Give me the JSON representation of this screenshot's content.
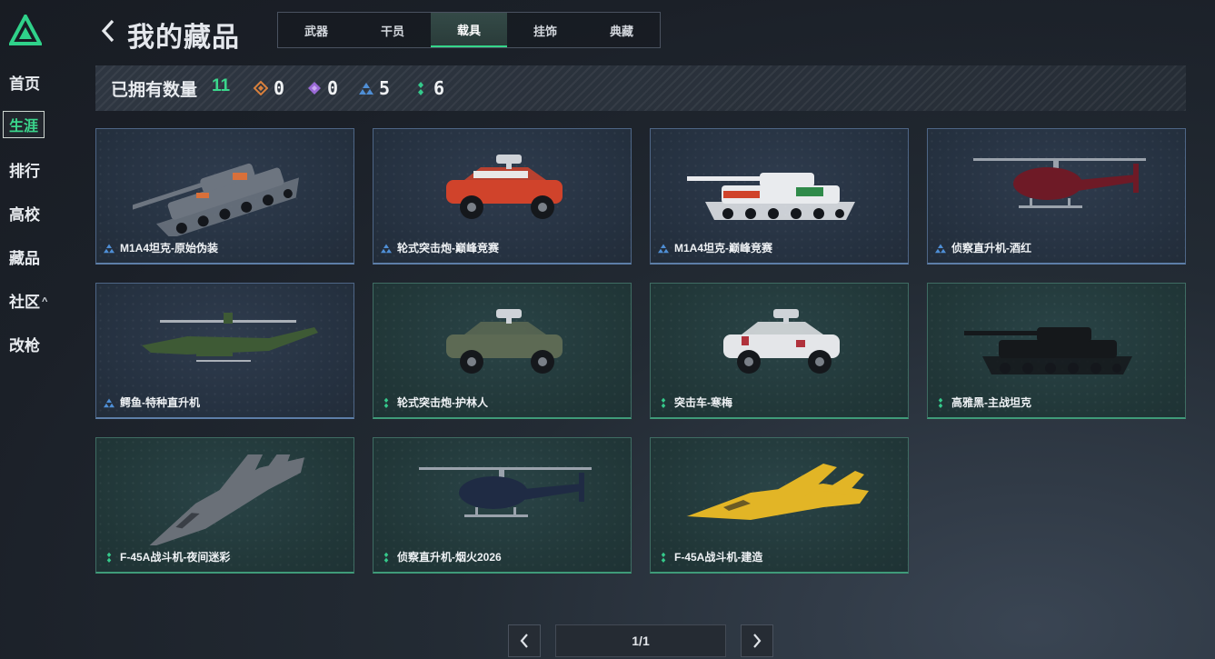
{
  "nav": {
    "items": [
      {
        "label": "首页"
      },
      {
        "label": "生涯"
      },
      {
        "label": "排行"
      },
      {
        "label": "高校"
      },
      {
        "label": "藏品"
      },
      {
        "label": "社区"
      },
      {
        "label": "改枪"
      }
    ],
    "community_caret": "^"
  },
  "header": {
    "title": "我的藏品",
    "tabs": [
      {
        "label": "武器"
      },
      {
        "label": "干员"
      },
      {
        "label": "载具"
      },
      {
        "label": "挂饰"
      },
      {
        "label": "典藏"
      }
    ],
    "active_tab": "载具"
  },
  "stats": {
    "owned_label": "已拥有数量",
    "owned_count": "11",
    "rarities": [
      {
        "name": "orange",
        "color": "#d9803c",
        "count": "0"
      },
      {
        "name": "purple",
        "color": "#9a6ad6",
        "count": "0"
      },
      {
        "name": "blue",
        "color": "#4f8fd6",
        "count": "5"
      },
      {
        "name": "green",
        "color": "#35c98b",
        "count": "6"
      }
    ]
  },
  "items": [
    {
      "name": "M1A4坦克-原始伪装",
      "rarity": "blue",
      "vehicle": "tank-camo-icon"
    },
    {
      "name": "轮式突击炮-巅峰竞赛",
      "rarity": "blue",
      "vehicle": "wheeled-assault-gun-red-icon"
    },
    {
      "name": "M1A4坦克-巅峰竞赛",
      "rarity": "blue",
      "vehicle": "tank-white-red-icon"
    },
    {
      "name": "侦察直升机-酒红",
      "rarity": "blue",
      "vehicle": "scout-helicopter-wine-icon"
    },
    {
      "name": "鳄鱼-特种直升机",
      "rarity": "blue",
      "vehicle": "attack-helicopter-green-icon"
    },
    {
      "name": "轮式突击炮-护林人",
      "rarity": "green",
      "vehicle": "wheeled-assault-gun-camo-icon"
    },
    {
      "name": "突击车-寒梅",
      "rarity": "green",
      "vehicle": "assault-vehicle-white-icon"
    },
    {
      "name": "高雅黑-主战坦克",
      "rarity": "green",
      "vehicle": "tank-black-icon"
    },
    {
      "name": "F-45A战斗机-夜间迷彩",
      "rarity": "green",
      "vehicle": "fighter-jet-camo-icon"
    },
    {
      "name": "侦察直升机-烟火2026",
      "rarity": "green",
      "vehicle": "scout-helicopter-navy-icon"
    },
    {
      "name": "F-45A战斗机-建造",
      "rarity": "green",
      "vehicle": "fighter-jet-yellow-icon"
    }
  ],
  "pager": {
    "page_text": "1/1"
  },
  "colors": {
    "accent": "#3bd68c",
    "rare_blue": "#4f8fd6",
    "rare_green": "#35c98b"
  }
}
